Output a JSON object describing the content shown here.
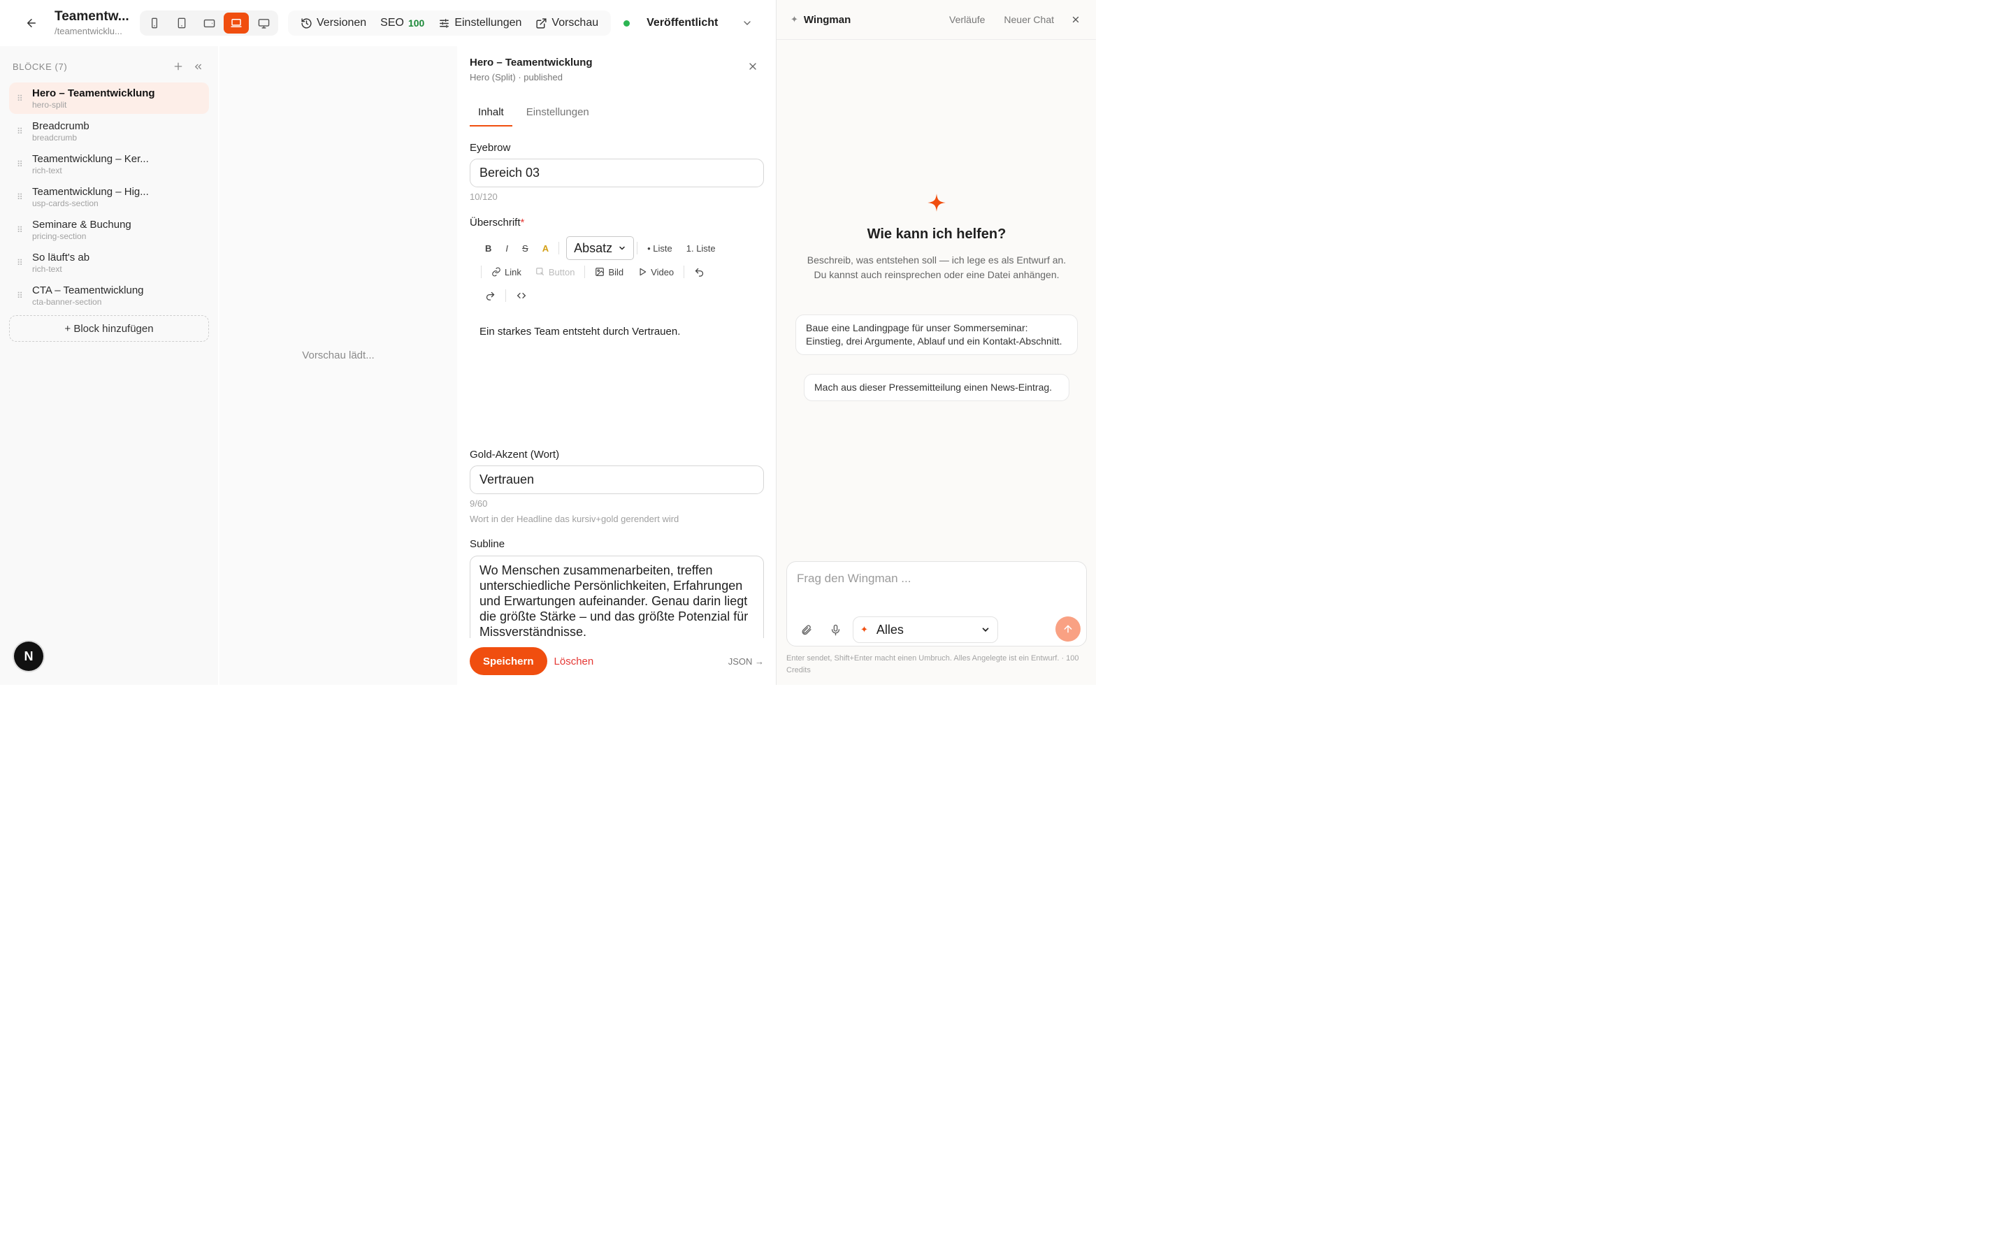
{
  "topbar": {
    "page_title": "Teamentw...",
    "page_slug": "/teamentwicklu...",
    "versions_label": "Versionen",
    "seo_label": "SEO",
    "seo_score": "100",
    "settings_label": "Einstellungen",
    "preview_label": "Vorschau",
    "status_label": "Veröffentlicht"
  },
  "sidebar": {
    "heading": "BLÖCKE (7)",
    "blocks": [
      {
        "name": "Hero – Teamentwicklung",
        "type": "hero-split"
      },
      {
        "name": "Breadcrumb",
        "type": "breadcrumb"
      },
      {
        "name": "Teamentwicklung – Ker...",
        "type": "rich-text"
      },
      {
        "name": "Teamentwicklung – Hig...",
        "type": "usp-cards-section"
      },
      {
        "name": "Seminare & Buchung",
        "type": "pricing-section"
      },
      {
        "name": "So läuft's ab",
        "type": "rich-text"
      },
      {
        "name": "CTA – Teamentwicklung",
        "type": "cta-banner-section"
      }
    ],
    "add_block_label": "+ Block hinzufügen",
    "avatar_letter": "N"
  },
  "preview": {
    "loading_text": "Vorschau lädt..."
  },
  "editor": {
    "title": "Hero – Teamentwicklung",
    "subtitle": "Hero (Split) · published",
    "tabs": [
      "Inhalt",
      "Einstellungen"
    ],
    "eyebrow": {
      "label": "Eyebrow",
      "value": "Bereich 03",
      "counter": "10/120"
    },
    "heading": {
      "label": "Überschrift",
      "required_mark": "*",
      "toolbar": {
        "bold": "B",
        "italic": "I",
        "strike": "S",
        "color": "A",
        "format": "Absatz",
        "bullet_list": "• Liste",
        "ordered_list": "1. Liste",
        "link": "Link",
        "button": "Button",
        "image": "Bild",
        "video": "Video"
      },
      "content": "Ein starkes Team entsteht durch Vertrauen."
    },
    "gold_accent": {
      "label": "Gold-Akzent (Wort)",
      "value": "Vertrauen",
      "counter": "9/60",
      "help": "Wort in der Headline das kursiv+gold gerendert wird"
    },
    "subline": {
      "label": "Subline",
      "value": "Wo Menschen zusammenarbeiten, treffen unterschiedliche Persönlichkeiten, Erfahrungen und Erwartungen aufeinander. Genau darin liegt die größte Stärke – und das größte Potenzial für Missverständnisse."
    },
    "save_label": "Speichern",
    "delete_label": "Löschen",
    "json_label": "JSON →"
  },
  "wingman": {
    "title": "Wingman",
    "history_label": "Verläufe",
    "new_chat_label": "Neuer Chat",
    "heading": "Wie kann ich helfen?",
    "description": "Beschreib, was entstehen soll — ich lege es als Entwurf an. Du kannst auch reinsprechen oder eine Datei anhängen.",
    "suggestions": [
      "Baue eine Landingpage für unser Sommerseminar: Einstieg, drei Argumente, Ablauf und ein Kontakt-Abschnitt.",
      "Mach aus dieser Pressemitteilung einen News-Eintrag."
    ],
    "input_placeholder": "Frag den Wingman ...",
    "scope_label": "Alles",
    "footer_note": "Enter sendet, Shift+Enter macht einen Umbruch. Alles Angelegte ist ein Entwurf. · 100 Credits"
  },
  "colors": {
    "accent": "#f04e0f",
    "active_block_bg": "#fdeee8",
    "status_green": "#2cb553",
    "seo_green": "#1d8a3a",
    "delete_red": "#e53935",
    "gold": "#d4a017"
  }
}
